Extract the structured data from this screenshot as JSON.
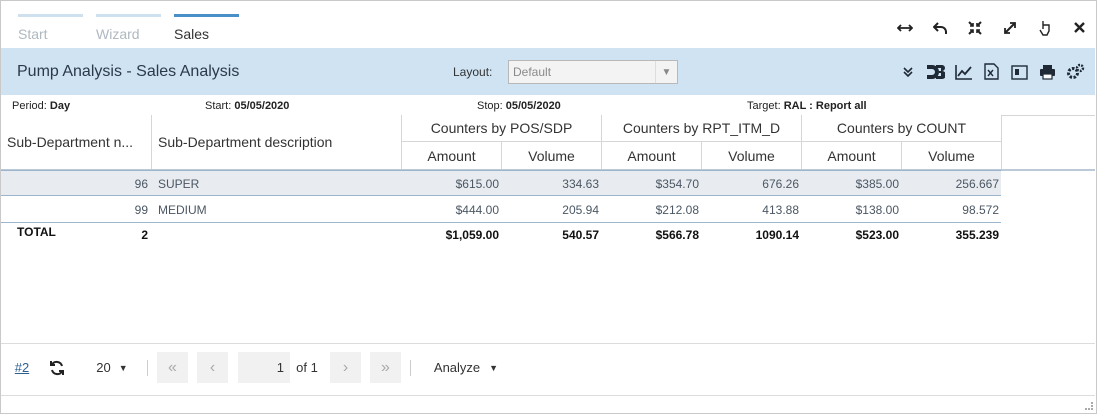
{
  "tabs": [
    "Start",
    "Wizard",
    "Sales"
  ],
  "window_icons": [
    "resize-horizontal-icon",
    "undo-icon",
    "collapse-icon",
    "expand-icon",
    "pointer-icon",
    "close-icon"
  ],
  "title": "Pump Analysis - Sales Analysis",
  "layout": {
    "label": "Layout:",
    "value": "Default"
  },
  "toolbar_icons": [
    "chevron-double-down-icon",
    "d3-icon",
    "line-chart-icon",
    "excel-export-icon",
    "report-icon",
    "print-icon",
    "settings-icon"
  ],
  "info": {
    "period_label": "Period:",
    "period_value": "Day",
    "start_label": "Start:",
    "start_value": "05/05/2020",
    "stop_label": "Stop:",
    "stop_value": "05/05/2020",
    "target_label": "Target:",
    "target_value": "RAL : Report all"
  },
  "columns": {
    "sub_dept_number": "Sub-Department n...",
    "sub_dept_description": "Sub-Department description",
    "groups": [
      "Counters by POS/SDP",
      "Counters by RPT_ITM_D",
      "Counters by COUNT"
    ],
    "amount": "Amount",
    "volume": "Volume"
  },
  "rows": [
    {
      "number": "96",
      "description": "SUPER",
      "pos_amount": "$615.00",
      "pos_volume": "334.63",
      "rpt_amount": "$354.70",
      "rpt_volume": "676.26",
      "count_amount": "$385.00",
      "count_volume": "256.667"
    },
    {
      "number": "99",
      "description": "MEDIUM",
      "pos_amount": "$444.00",
      "pos_volume": "205.94",
      "rpt_amount": "$212.08",
      "rpt_volume": "413.88",
      "count_amount": "$138.00",
      "count_volume": "98.572"
    }
  ],
  "total": {
    "label": "TOTAL",
    "number": "2",
    "pos_amount": "$1,059.00",
    "pos_volume": "540.57",
    "rpt_amount": "$566.78",
    "rpt_volume": "1090.14",
    "count_amount": "$523.00",
    "count_volume": "355.239"
  },
  "pager": {
    "ref": "#2",
    "page_size": "20",
    "page": "1",
    "of": "of 1",
    "analyze": "Analyze"
  }
}
